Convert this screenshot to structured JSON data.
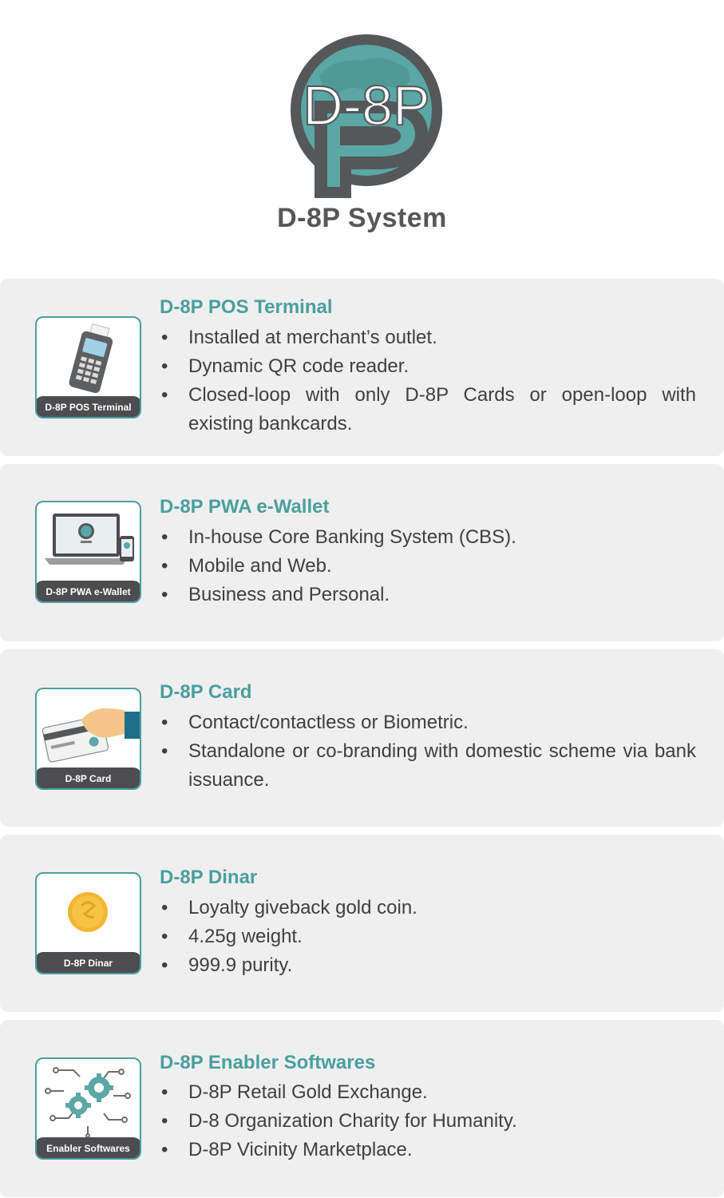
{
  "header": {
    "logo_text": "D-8P",
    "system_title": "D-8P System"
  },
  "colors": {
    "accent": "#4a9f9e",
    "dark": "#4d4d4f",
    "card_bg": "#efefef",
    "gold": "#f2b630"
  },
  "cards": [
    {
      "title": "D-8P POS Terminal",
      "thumb_label": "D-8P POS Terminal",
      "icon": "pos-terminal-icon",
      "bullets": [
        "Installed at merchant’s outlet.",
        "Dynamic QR code reader.",
        "Closed-loop with only D-8P Cards or open-loop with existing bankcards."
      ]
    },
    {
      "title": "D-8P PWA e-Wallet",
      "thumb_label": "D-8P PWA e-Wallet",
      "icon": "laptop-phone-icon",
      "bullets": [
        "In-house Core Banking System (CBS).",
        "Mobile and Web.",
        "Business and Personal."
      ]
    },
    {
      "title": "D-8P Card",
      "thumb_label": "D-8P Card",
      "icon": "card-in-hand-icon",
      "bullets": [
        "Contact/contactless or Biometric.",
        "Standalone or co-branding with domestic scheme via bank issuance."
      ]
    },
    {
      "title": "D-8P Dinar",
      "thumb_label": "D-8P Dinar",
      "icon": "gold-coin-icon",
      "bullets": [
        "Loyalty giveback gold coin.",
        "4.25g weight.",
        "999.9 purity."
      ]
    },
    {
      "title": "D-8P Enabler Softwares",
      "thumb_label": "Enabler Softwares",
      "icon": "gears-circuit-icon",
      "bullets": [
        "D-8P Retail Gold Exchange.",
        "D-8 Organization Charity for Humanity.",
        "D-8P Vicinity Marketplace."
      ]
    }
  ]
}
